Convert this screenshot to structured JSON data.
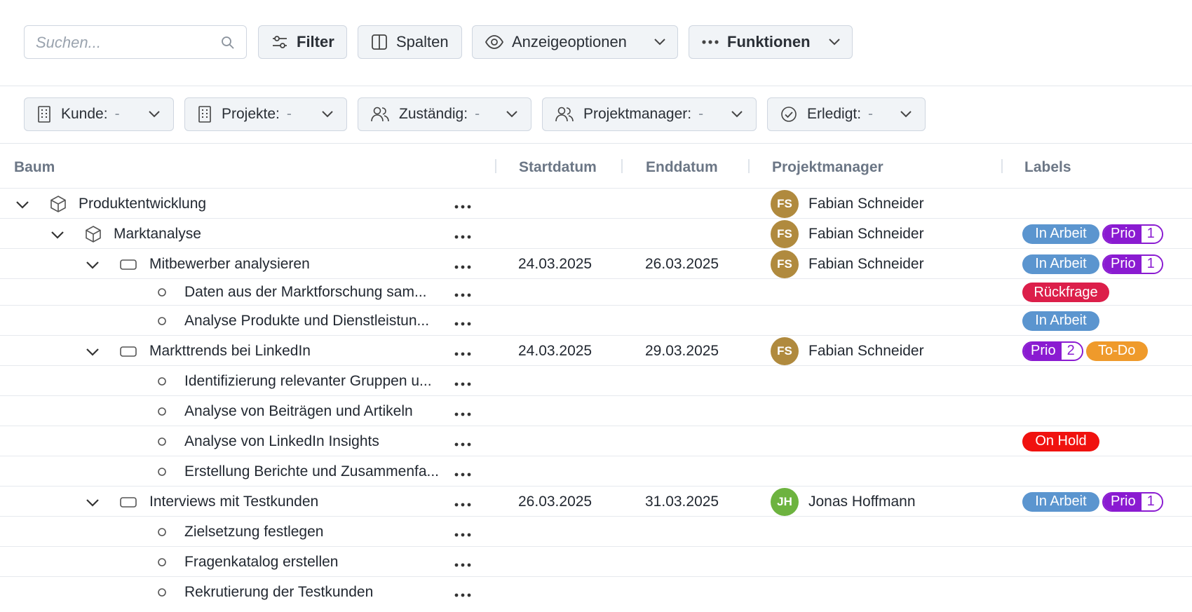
{
  "toolbar": {
    "search_placeholder": "Suchen...",
    "filter_label": "Filter",
    "columns_label": "Spalten",
    "display_label": "Anzeigeoptionen",
    "functions_label": "Funktionen"
  },
  "filters": {
    "customer": {
      "label": "Kunde:",
      "value": "-"
    },
    "projects": {
      "label": "Projekte:",
      "value": "-"
    },
    "assignee": {
      "label": "Zuständig:",
      "value": "-"
    },
    "pm": {
      "label": "Projektmanager:",
      "value": "-"
    },
    "done": {
      "label": "Erledigt:",
      "value": "-"
    }
  },
  "table": {
    "headers": {
      "tree": "Baum",
      "start": "Startdatum",
      "end": "Enddatum",
      "pm": "Projektmanager",
      "labels": "Labels"
    },
    "rows": [
      {
        "name": "Produktentwicklung",
        "start": "",
        "end": "",
        "pm": "Fabian Schneider",
        "initials": "FS"
      },
      {
        "name": "Marktanalyse",
        "start": "",
        "end": "",
        "pm": "Fabian Schneider",
        "initials": "FS",
        "label1": "In Arbeit",
        "prio": "Prio",
        "prio_num": "1"
      },
      {
        "name": "Mitbewerber analysieren",
        "start": "24.03.2025",
        "end": "26.03.2025",
        "pm": "Fabian Schneider",
        "initials": "FS",
        "label1": "In Arbeit",
        "prio": "Prio",
        "prio_num": "1"
      },
      {
        "name": "Daten aus der Marktforschung sam...",
        "label1": "Rückfrage"
      },
      {
        "name": "Analyse Produkte und Dienstleistun...",
        "label1": "In Arbeit"
      },
      {
        "name": "Markttrends bei LinkedIn",
        "start": "24.03.2025",
        "end": "29.03.2025",
        "pm": "Fabian Schneider",
        "initials": "FS",
        "prio": "Prio",
        "prio_num": "2",
        "label2": "To-Do"
      },
      {
        "name": "Identifizierung relevanter Gruppen u..."
      },
      {
        "name": "Analyse von Beiträgen und Artikeln"
      },
      {
        "name": "Analyse von LinkedIn Insights",
        "label1": "On Hold"
      },
      {
        "name": "Erstellung Berichte und Zusammenfa..."
      },
      {
        "name": "Interviews mit Testkunden",
        "start": "26.03.2025",
        "end": "31.03.2025",
        "pm": "Jonas Hoffmann",
        "initials": "JH",
        "label1": "In Arbeit",
        "prio": "Prio",
        "prio_num": "1"
      },
      {
        "name": "Zielsetzung festlegen"
      },
      {
        "name": "Fragenkatalog erstellen"
      },
      {
        "name": "Rekrutierung der Testkunden"
      }
    ]
  },
  "colors": {
    "in_arbeit": "#5b95cf",
    "prio": "#8a1bd1",
    "rueckfrage": "#dc1f4a",
    "todo": "#ef9a2b",
    "on_hold": "#f0120f",
    "avatar_fs": "#b08a3e",
    "avatar_jh": "#6db33f"
  },
  "icons": [
    "search-icon",
    "filter-sliders-icon",
    "columns-icon",
    "eye-icon",
    "more-dots-icon",
    "chevron-down-icon",
    "building-icon",
    "users-icon",
    "check-circle-icon",
    "cube-icon",
    "rectangle-icon",
    "circle-icon"
  ]
}
